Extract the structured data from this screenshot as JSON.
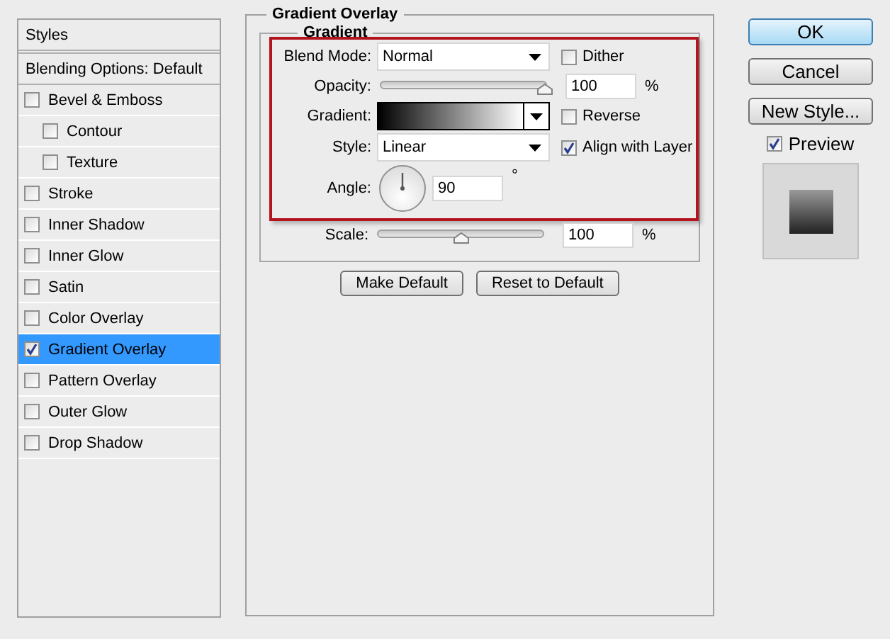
{
  "sidebar": {
    "title": "Styles",
    "blending_options": "Blending Options: Default",
    "items": [
      {
        "label": "Bevel & Emboss",
        "checked": false,
        "selected": false,
        "children": [
          {
            "label": "Contour",
            "checked": false,
            "selected": false
          },
          {
            "label": "Texture",
            "checked": false,
            "selected": false
          }
        ]
      },
      {
        "label": "Stroke",
        "checked": false,
        "selected": false
      },
      {
        "label": "Inner Shadow",
        "checked": false,
        "selected": false
      },
      {
        "label": "Inner Glow",
        "checked": false,
        "selected": false
      },
      {
        "label": "Satin",
        "checked": false,
        "selected": false
      },
      {
        "label": "Color Overlay",
        "checked": false,
        "selected": false
      },
      {
        "label": "Gradient Overlay",
        "checked": true,
        "selected": true
      },
      {
        "label": "Pattern Overlay",
        "checked": false,
        "selected": false
      },
      {
        "label": "Outer Glow",
        "checked": false,
        "selected": false
      },
      {
        "label": "Drop Shadow",
        "checked": false,
        "selected": false
      }
    ]
  },
  "panel": {
    "title": "Gradient Overlay",
    "group": "Gradient",
    "blend_mode": {
      "label": "Blend Mode:",
      "value": "Normal"
    },
    "dither": {
      "label": "Dither",
      "checked": false
    },
    "opacity": {
      "label": "Opacity:",
      "level": 1,
      "value": "100",
      "unit": "%"
    },
    "gradient": {
      "label": "Gradient:"
    },
    "reverse": {
      "label": "Reverse",
      "checked": false
    },
    "style": {
      "label": "Style:",
      "value": "Linear"
    },
    "align_with_layer": {
      "label": "Align with Layer",
      "checked": true
    },
    "angle": {
      "label": "Angle:",
      "value": "90",
      "unit": "°"
    },
    "scale": {
      "label": "Scale:",
      "level": 0.5,
      "value": "100",
      "unit": "%"
    },
    "buttons": [
      "Make Default",
      "Reset to Default"
    ]
  },
  "actions": {
    "buttons": [
      {
        "label": "OK",
        "default": true
      },
      {
        "label": "Cancel",
        "default": false
      },
      {
        "label": "New Style...",
        "default": false
      }
    ],
    "preview": {
      "label": "Preview",
      "checked": true
    }
  }
}
